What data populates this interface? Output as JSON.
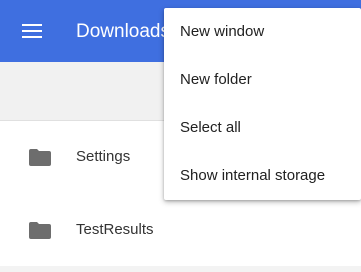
{
  "app_bar": {
    "title": "Downloads",
    "menu_icon": "hamburger-menu-icon",
    "background_color": "#3f6fe0"
  },
  "files": [
    {
      "name": "Settings",
      "icon": "folder-icon"
    },
    {
      "name": "TestResults",
      "icon": "folder-icon"
    }
  ],
  "overflow_menu": {
    "items": [
      {
        "label": "New window"
      },
      {
        "label": "New folder"
      },
      {
        "label": "Select all"
      },
      {
        "label": "Show internal storage"
      }
    ]
  }
}
